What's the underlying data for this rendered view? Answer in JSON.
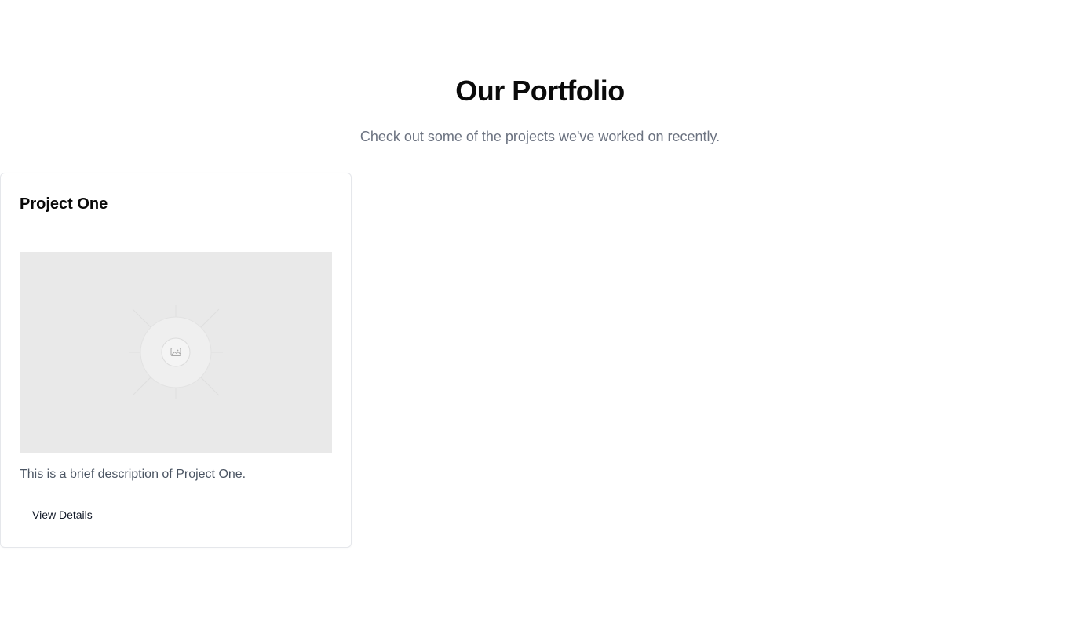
{
  "header": {
    "title": "Our Portfolio",
    "subtitle": "Check out some of the projects we've worked on recently."
  },
  "projects": [
    {
      "title": "Project One",
      "image_icon": "image-placeholder-icon",
      "description": "This is a brief description of Project One.",
      "button_label": "View Details"
    }
  ],
  "colors": {
    "title": "#0a0a0a",
    "subtitle": "#6b7280",
    "description": "#4b5563",
    "card_border": "#e5e7eb",
    "image_placeholder_bg": "#e9e9e9"
  }
}
